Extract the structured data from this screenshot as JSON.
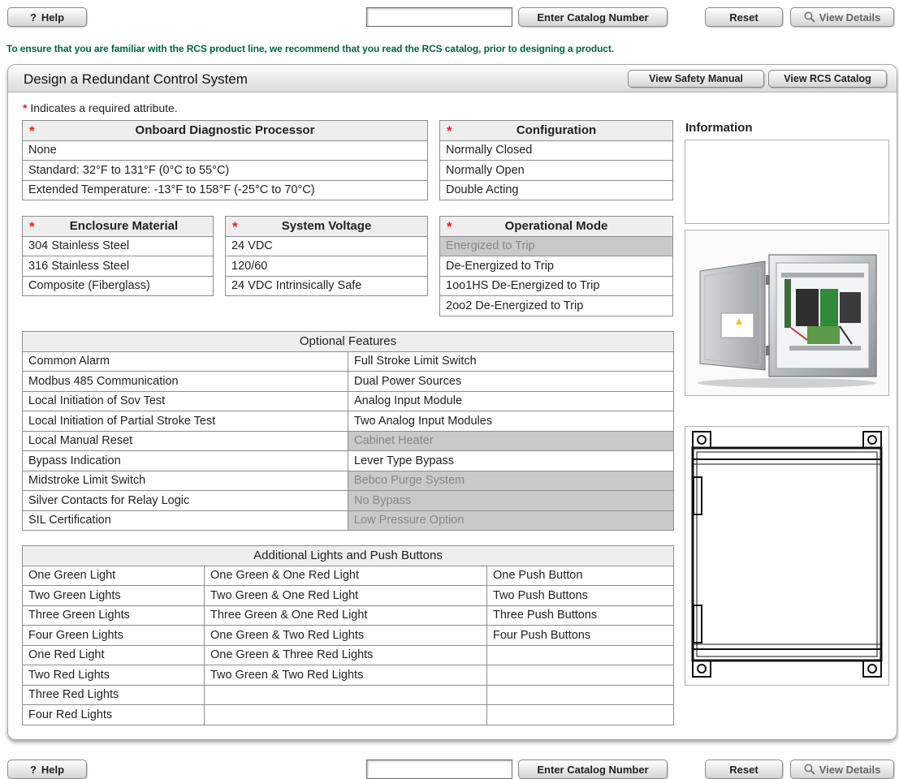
{
  "toolbar": {
    "help_label": "Help",
    "help_glyph": "?",
    "catalog_input_value": "",
    "enter_catalog_label": "Enter Catalog Number",
    "reset_label": "Reset",
    "view_details_label": "View Details"
  },
  "notice": "To ensure that you are familiar with the RCS product line, we recommend that you read the RCS catalog, prior to designing a product.",
  "panel": {
    "title": "Design a Redundant Control System",
    "safety_manual_label": "View Safety Manual",
    "rcs_catalog_label": "View RCS Catalog"
  },
  "required_marker": "*",
  "required_note": "Indicates a required attribute.",
  "odp": {
    "title": "Onboard Diagnostic Processor",
    "options": [
      "None",
      "Standard: 32°F to 131°F (0°C to 55°C)",
      "Extended Temperature: -13°F to 158°F (-25°C to 70°C)"
    ]
  },
  "configuration": {
    "title": "Configuration",
    "options": [
      "Normally Closed",
      "Normally Open",
      "Double Acting"
    ]
  },
  "enclosure": {
    "title": "Enclosure Material",
    "options": [
      "304 Stainless Steel",
      "316 Stainless Steel",
      "Composite (Fiberglass)"
    ]
  },
  "voltage": {
    "title": "System Voltage",
    "options": [
      "24 VDC",
      "120/60",
      "24 VDC Intrinsically Safe"
    ]
  },
  "opmode": {
    "title": "Operational Mode",
    "options": [
      "Energized to Trip",
      "De-Energized to Trip",
      "1oo1HS De-Energized to Trip",
      "2oo2 De-Energized to Trip"
    ],
    "disabled": [
      true,
      false,
      false,
      false
    ]
  },
  "optional_features": {
    "title": "Optional Features",
    "left": [
      "Common Alarm",
      "Modbus 485 Communication",
      "Local Initiation of Sov Test",
      "Local Initiation of Partial Stroke Test",
      "Local Manual Reset",
      "Bypass Indication",
      "Midstroke Limit Switch",
      "Silver Contacts for Relay Logic",
      "SIL Certification"
    ],
    "right": [
      "Full Stroke Limit Switch",
      "Dual Power Sources",
      "Analog Input Module",
      "Two Analog Input Modules",
      "Cabinet Heater",
      "Lever Type Bypass",
      "Bebco Purge System",
      "No Bypass",
      "Low Pressure Option"
    ],
    "right_disabled": [
      false,
      false,
      false,
      false,
      true,
      false,
      true,
      true,
      true
    ]
  },
  "lights": {
    "title": "Additional Lights and Push Buttons",
    "col1": [
      "One Green Light",
      "Two Green Lights",
      "Three Green Lights",
      "Four Green Lights",
      "One Red Light",
      "Two Red Lights",
      "Three Red Lights",
      "Four Red Lights"
    ],
    "col2": [
      "One Green & One Red Light",
      "Two Green & One Red Light",
      "Three Green & One Red Light",
      "One Green & Two Red Lights",
      "One Green & Three Red Lights",
      "Two Green & Two Red Lights",
      "",
      ""
    ],
    "col3": [
      "One Push Button",
      "Two Push Buttons",
      "Three Push Buttons",
      "Four Push Buttons",
      "",
      "",
      "",
      ""
    ]
  },
  "information": {
    "label": "Information",
    "text": ""
  },
  "colors": {
    "notice_green": "#00683a",
    "required_red": "#e0231c",
    "disabled_gray": "#c9c9c9"
  }
}
